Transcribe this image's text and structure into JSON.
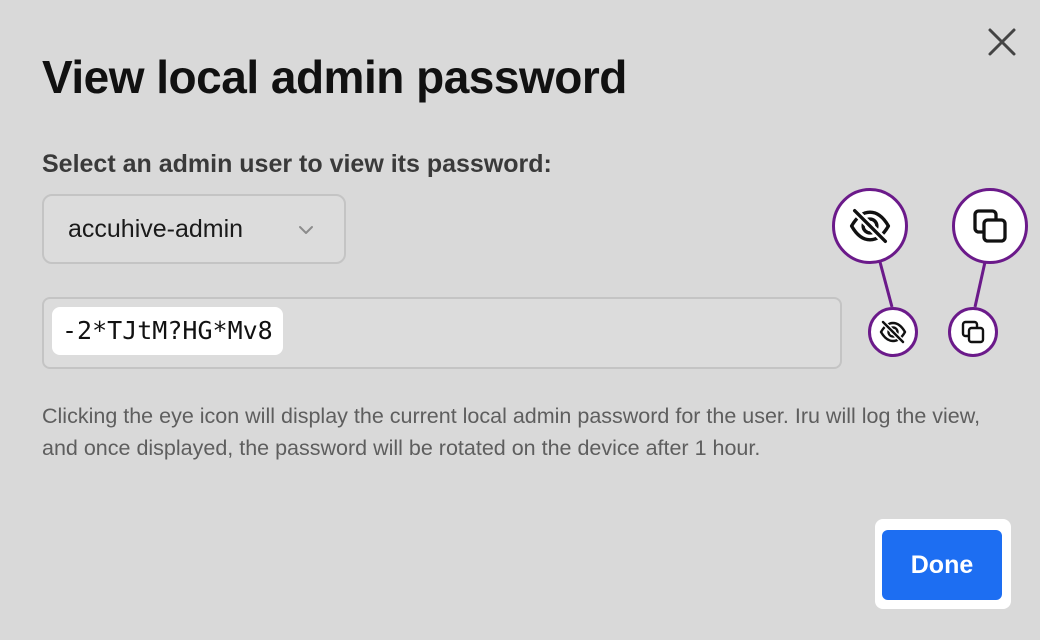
{
  "dialog": {
    "title": "View local admin password",
    "select_label": "Select an admin user to view its password:",
    "selected_user": "accuhive-admin",
    "password": "-2*TJtM?HG*Mv8",
    "help_text": "Clicking the eye icon will display the current local admin password for the user. Iru will log the view, and once displayed, the password will be rotated on the device after 1 hour.",
    "done_label": "Done"
  },
  "icons": {
    "close": "close-icon",
    "chevron": "chevron-down-icon",
    "reveal": "eye-off-icon",
    "copy": "copy-icon"
  },
  "colors": {
    "background": "#d9d9d9",
    "primary_button": "#1d6ef2",
    "callout_ring": "#6b1a8a"
  }
}
